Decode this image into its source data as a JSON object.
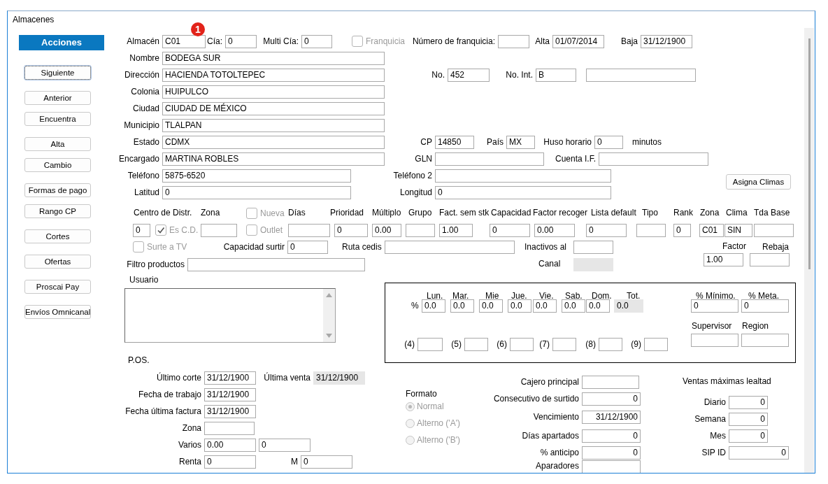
{
  "window": {
    "title": "Almacenes"
  },
  "badge": "1",
  "sidebar": {
    "title": "Acciones",
    "buttons": [
      {
        "label": "Siguiente",
        "focused": true
      },
      {
        "label": "Anterior",
        "focused": false
      },
      {
        "label": "Encuentra",
        "focused": false
      },
      {
        "label": "Alta",
        "focused": false
      },
      {
        "label": "Cambio",
        "focused": false
      },
      {
        "label": "Formas de pago",
        "focused": false
      },
      {
        "label": "Rango CP",
        "focused": false
      },
      {
        "label": "Cortes",
        "focused": false
      },
      {
        "label": "Ofertas",
        "focused": false
      },
      {
        "label": "Proscai Pay",
        "focused": false
      },
      {
        "label": "Envíos Omnicanal",
        "focused": false
      }
    ]
  },
  "fields": [
    {
      "label": "Almacén",
      "value": "C01"
    },
    {
      "label": "Cía:",
      "value": "0"
    },
    {
      "label": "Multi Cía:",
      "value": "0"
    },
    {
      "label": "Número de franquicia:"
    },
    {
      "label": "Alta",
      "value": "01/07/2014"
    },
    {
      "label": "Baja",
      "value": "31/12/1900"
    },
    {
      "label": "Nombre",
      "value": "BODEGA SUR"
    },
    {
      "label": "Dirección",
      "value": "HACIENDA TOTOLTEPEC"
    },
    {
      "label": "No.",
      "value": "452"
    },
    {
      "label": "No. Int.",
      "value": "B"
    },
    {
      "readonly": false
    },
    {
      "label": "Colonia",
      "value": "HUIPULCO"
    },
    {
      "label": "Ciudad",
      "value": "CIUDAD DE MÉXICO"
    },
    {
      "label": "Municipio",
      "value": "TLALPAN"
    },
    {
      "label": "Estado",
      "value": "CDMX"
    },
    {
      "label": "CP",
      "value": "14850"
    },
    {
      "label": "País",
      "value": "MX"
    },
    {
      "label": "Huso horario",
      "value": "0"
    },
    {
      "label": "Encargado",
      "value": "MARTINA ROBLES"
    },
    {
      "label": "GLN"
    },
    {
      "label": "Cuenta I.F."
    },
    {
      "label": "Teléfono",
      "value": "5875-6520"
    },
    {
      "label": "Teléfono 2"
    },
    {
      "label": "Latitud",
      "value": "0"
    },
    {
      "label": "Longitud",
      "value": "0"
    },
    {
      "label": "Centro de Distr.",
      "value": "0"
    },
    {
      "label": "Zona"
    },
    {
      "label": "Días"
    },
    {
      "label": "Prioridad",
      "value": "0"
    },
    {
      "label": "Múltiplo",
      "value": "0.00"
    },
    {
      "label": "Grupo"
    },
    {
      "label": "Fact. sem stk",
      "value": "1.00"
    },
    {
      "label": "Capacidad",
      "value": "0"
    },
    {
      "label": "Factor recoger",
      "value": "0.00"
    },
    {
      "label": "Lista default",
      "value": "0"
    },
    {
      "label": "Tipo"
    },
    {
      "label": "Rank",
      "value": "0"
    },
    {
      "label": "Zona",
      "value": "C01"
    },
    {
      "label": "Clima",
      "value": "SIN"
    },
    {
      "label": "Tda Base"
    },
    {
      "label": "Capacidad surtir",
      "value": "0"
    },
    {
      "label": "Ruta cedis"
    },
    {
      "label": "Inactivos al"
    },
    {
      "label": "Factor",
      "value": "1.00"
    },
    {
      "label": "Rebaja"
    },
    {
      "label": "Filtro productos"
    },
    {
      "label": "Canal",
      "readonly": true
    },
    {
      "label": "Lun.",
      "value": "0.0"
    },
    {
      "label": "Mar.",
      "value": "0.0"
    },
    {
      "label": "Mie",
      "value": "0.0"
    },
    {
      "label": "Jue.",
      "value": "0.0"
    },
    {
      "label": "Vie.",
      "value": "0.0"
    },
    {
      "label": "Sab.",
      "value": "0.0"
    },
    {
      "label": "Dom.",
      "value": "0.0"
    },
    {
      "label": "Tot.",
      "value": "0.0",
      "readonly": true
    },
    {
      "label": "% Mínimo.",
      "value": "0"
    },
    {
      "label": "% Meta.",
      "value": "0"
    },
    {
      "label": "(4)"
    },
    {
      "label": "(5)"
    },
    {
      "label": "(6)"
    },
    {
      "label": "(7)"
    },
    {
      "label": "(8)"
    },
    {
      "label": "(9)"
    },
    {
      "label": "Supervisor"
    },
    {
      "label": "Region"
    },
    {
      "label": "Último corte",
      "value": "31/12/1900"
    },
    {
      "label": "Última venta",
      "value": "31/12/1900",
      "readonly": true
    },
    {
      "label": "Fecha de trabajo",
      "value": "31/12/1900"
    },
    {
      "label": "Fecha última factura",
      "value": "31/12/1900"
    },
    {
      "label": "Zona"
    },
    {
      "label": "Varios",
      "value": "0.00"
    },
    {
      "value": "0"
    },
    {
      "label": "Renta",
      "value": "0"
    },
    {
      "label": "M",
      "value": "0"
    },
    {
      "label": "Cajero principal"
    },
    {
      "label": "Consecutivo de surtido",
      "value": "0"
    },
    {
      "label": "Vencimiento",
      "value": "31/12/1900"
    },
    {
      "label": "Días apartados",
      "value": "0"
    },
    {
      "label": "% anticipo",
      "value": "0"
    },
    {
      "label": "Aparadores"
    },
    {
      "label": "Diario",
      "value": "0"
    },
    {
      "label": "Semana",
      "value": "0"
    },
    {
      "label": "Mes",
      "value": "0"
    },
    {
      "label": "SIP ID",
      "value": "0"
    }
  ],
  "checkboxes": [
    {
      "label": "Franquicia",
      "checked": false,
      "disabled": true
    },
    {
      "label": "Nueva",
      "checked": false,
      "disabled": true
    },
    {
      "label": "Es C.D.",
      "checked": true,
      "disabled": true
    },
    {
      "label": "Outlet",
      "checked": false,
      "disabled": true
    },
    {
      "label": "Surte a TV",
      "checked": false,
      "disabled": true
    }
  ],
  "captions": [
    "minutos",
    "%",
    "Usuario",
    "P.OS.",
    "Ventas máximas lealtad"
  ],
  "asigna_button": "Asigna Climas",
  "formato": {
    "label": "Formato",
    "options": [
      {
        "label": "Normal",
        "selected": true,
        "disabled": true
      },
      {
        "label": "Alterno ('A')",
        "selected": false,
        "disabled": true
      },
      {
        "label": "Alterno ('B')",
        "selected": false,
        "disabled": true
      }
    ]
  }
}
